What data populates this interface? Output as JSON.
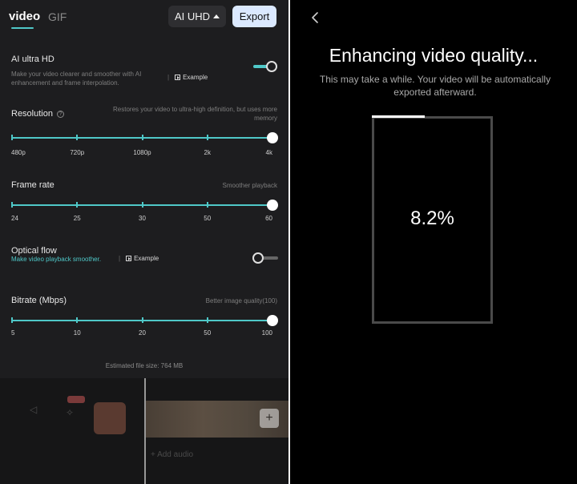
{
  "left": {
    "tabs": {
      "video": "video",
      "gif": "GIF"
    },
    "quality_button": "AI UHD",
    "export_button": "Export",
    "ai_ultra_hd": {
      "title": "AI ultra HD",
      "description_line1": "Make your video clearer and smoother with AI",
      "description_line2": "enhancement and frame interpolation.",
      "example": "Example",
      "toggle_on": true
    },
    "resolution": {
      "title": "Resolution",
      "hint_line1": "Restores your video to ultra-high definition, but uses more",
      "hint_line2": "memory",
      "ticks": [
        "480p",
        "720p",
        "1080p",
        "2k",
        "4k"
      ],
      "selected_index": 4
    },
    "frame_rate": {
      "title": "Frame rate",
      "hint": "Smoother playback",
      "ticks": [
        "24",
        "25",
        "30",
        "50",
        "60"
      ],
      "selected_index": 4
    },
    "optical_flow": {
      "title": "Optical flow",
      "subtitle": "Make video playback smoother.",
      "example": "Example",
      "toggle_on": false
    },
    "bitrate": {
      "title": "Bitrate (Mbps)",
      "hint": "Better image quality(100)",
      "ticks": [
        "5",
        "10",
        "20",
        "50",
        "100"
      ],
      "selected_index": 4
    },
    "estimated_file_size": "Estimated file size: 764 MB",
    "timeline": {
      "add_audio": "+ Add audio",
      "plus": "+"
    }
  },
  "right": {
    "title": "Enhancing video quality...",
    "subtitle": "This may take a while. Your video will be automatically exported afterward.",
    "progress_percent": 8.2,
    "progress_text": "8.2%"
  },
  "colors": {
    "accent": "#4fc8c8",
    "export_bg": "#dbe9ff",
    "panel_bg": "#1d1d1f",
    "right_bg": "#000000"
  }
}
